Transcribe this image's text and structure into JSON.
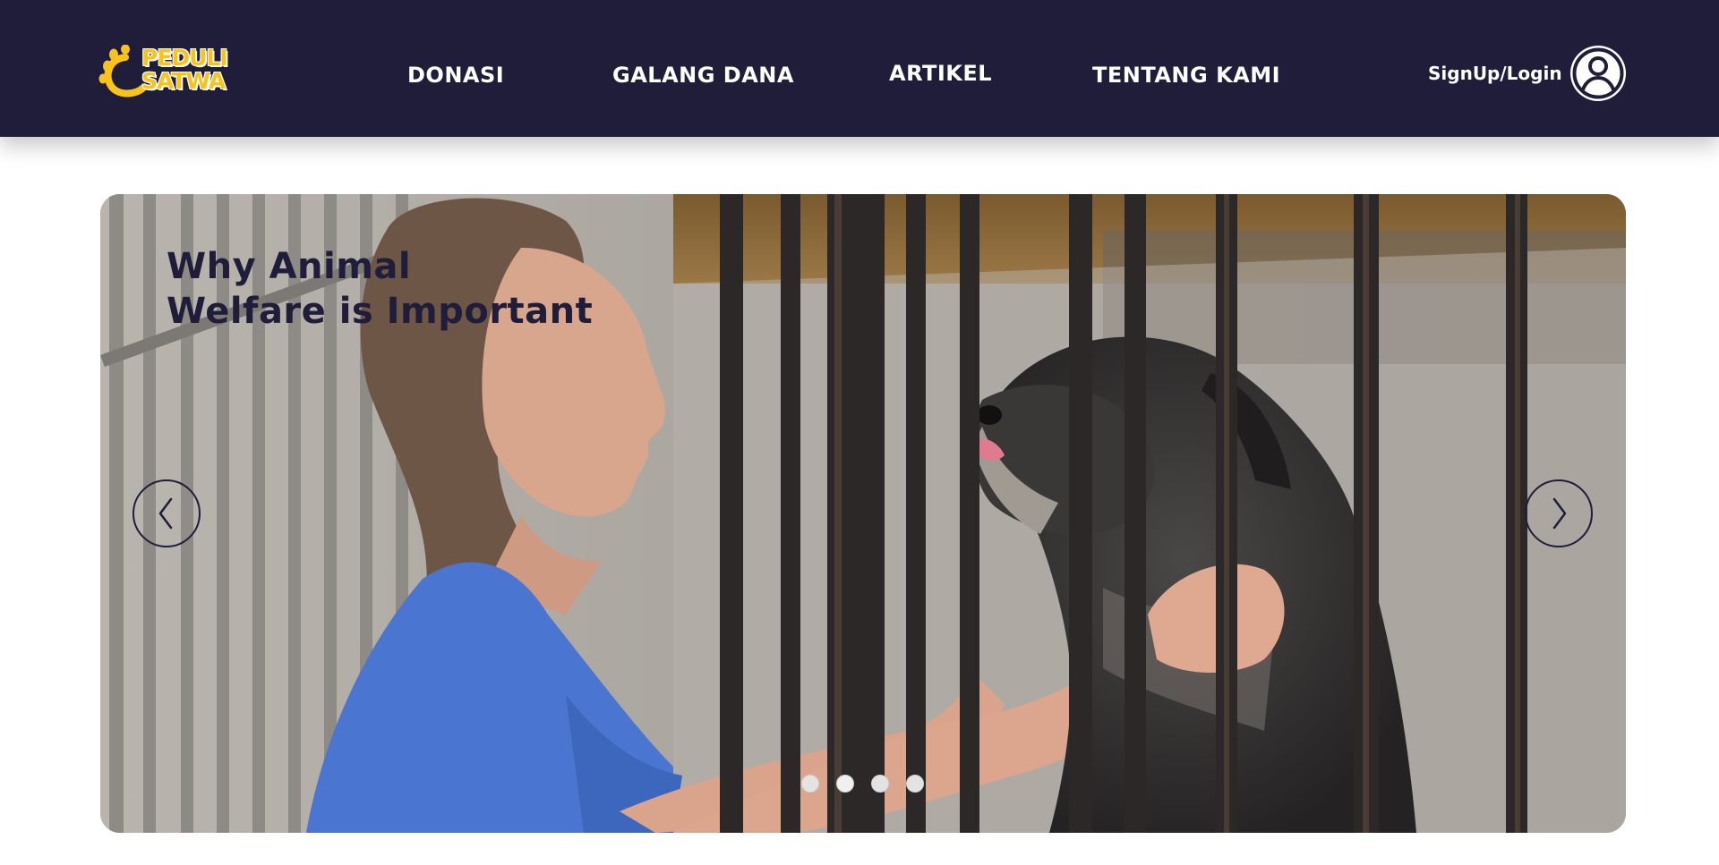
{
  "brand": {
    "logo_line1": "PEDULI",
    "logo_line2": "SATWA",
    "primary_color": "#1f1d39",
    "accent_color": "#f9c31c"
  },
  "nav": {
    "items": [
      {
        "label": "DONASI"
      },
      {
        "label": "GALANG DANA"
      },
      {
        "label": "ARTIKEL"
      },
      {
        "label": "TENTANG KAMI"
      }
    ]
  },
  "auth": {
    "label": "SignUp/Login",
    "icon": "user-circle-icon"
  },
  "hero": {
    "title_line1": "Why Animal",
    "title_line2": "Welfare is Important",
    "prev_icon": "chevron-left-icon",
    "next_icon": "chevron-right-icon",
    "slides_count": 4,
    "active_slide": 2
  }
}
